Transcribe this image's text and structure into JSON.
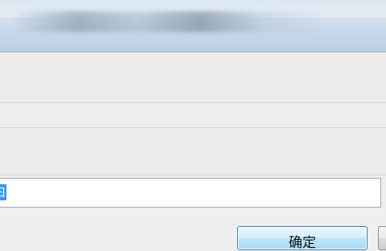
{
  "window": {
    "title": ""
  },
  "input": {
    "selected_text": "曰"
  },
  "buttons": {
    "ok_label": "确定"
  },
  "colors": {
    "titlebar": "#c9dbea",
    "dialog_background": "#ececec",
    "selection": "#3399ff",
    "button_border": "#3c7fb1"
  }
}
